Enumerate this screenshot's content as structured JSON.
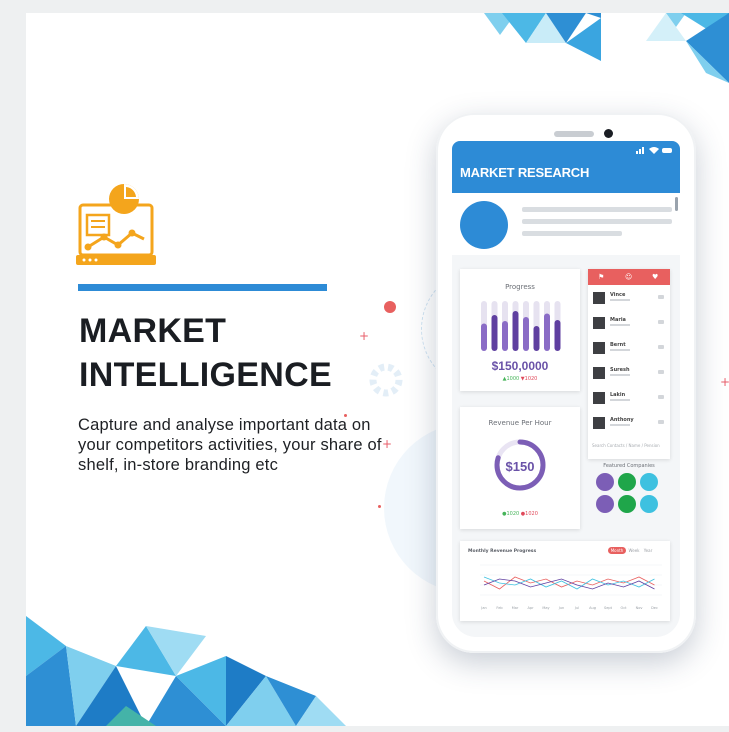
{
  "headline": {
    "line1": "MARKET",
    "line2": "INTELLIGENCE"
  },
  "description": "Capture and analyse important data on your competitors activities, your share of shelf, in-store branding etc",
  "colors": {
    "accent_blue": "#2d8bd6",
    "icon_orange": "#f4a51c",
    "purple": "#6a52a8",
    "coral": "#e8605f",
    "green": "#1fa64a",
    "cyan": "#3ec1e0"
  },
  "phone": {
    "app_title": "MARKET RESEARCH",
    "status_icons": "signal-wifi-battery",
    "progress": {
      "title": "Progress",
      "value": "$150,0000",
      "legend_up": "▲1000",
      "legend_down": "▼1020",
      "bars": [
        0.55,
        0.72,
        0.6,
        0.8,
        0.68,
        0.5,
        0.75,
        0.62
      ]
    },
    "revenue": {
      "title": "Revenue Per Hour",
      "value": "$150",
      "legend_up": "●1020",
      "legend_down": "●1020",
      "ring_fraction": 0.8
    },
    "contacts": [
      {
        "name": "Vince"
      },
      {
        "name": "Maria"
      },
      {
        "name": "Bernt"
      },
      {
        "name": "Suresh"
      },
      {
        "name": "Lakin"
      },
      {
        "name": "Anthony"
      }
    ],
    "contacts_search_placeholder": "Search Contacts / Name / Pension",
    "featured": {
      "title": "Featured Companies",
      "dot_colors": [
        "#7c5eb6",
        "#1fa64a",
        "#3ec1e0",
        "#7c5eb6",
        "#1fa64a",
        "#3ec1e0"
      ]
    },
    "monthly": {
      "title": "Monthly Revenue Progress",
      "tabs": [
        "Month",
        "Week",
        "Year"
      ],
      "months": [
        "Jan",
        "Feb",
        "Mar",
        "Apr",
        "May",
        "Jun",
        "Jul",
        "Aug",
        "Sept",
        "Oct",
        "Nov",
        "Dec"
      ]
    }
  }
}
